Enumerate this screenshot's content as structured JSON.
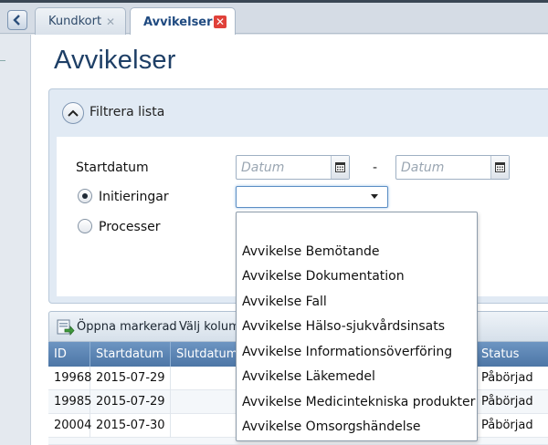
{
  "tabs": [
    {
      "label": "Kundkort",
      "active": false
    },
    {
      "label": "Avvikelser",
      "active": true
    }
  ],
  "page": {
    "title": "Avvikelser"
  },
  "filter": {
    "header_label": "Filtrera lista",
    "startdatum_label": "Startdatum",
    "date_from_placeholder": "Datum",
    "date_to_placeholder": "Datum",
    "range_separator": "-",
    "radio_initieringar": "Initieringar",
    "radio_processer": "Processer",
    "selected_radio": "Initieringar",
    "combo_value": ""
  },
  "dropdown": {
    "options": [
      "",
      "Avvikelse Bemötande",
      "Avvikelse Dokumentation",
      "Avvikelse Fall",
      "Avvikelse Hälso-sjukvårdsinsats",
      "Avvikelse Informationsöverföring",
      "Avvikelse Läkemedel",
      "Avvikelse Medicintekniska produkter",
      "Avvikelse Omsorgshändelse"
    ]
  },
  "toolbar": {
    "open_marked": "Öppna markerad",
    "choose_columns": "Välj kolumner"
  },
  "grid": {
    "columns": [
      "ID",
      "Startdatum",
      "Slutdatum",
      "Status"
    ],
    "rows": [
      {
        "id": "19968",
        "start": "2015-07-29",
        "end": "",
        "status": "Påbörjad"
      },
      {
        "id": "19985",
        "start": "2015-07-29",
        "end": "",
        "status": "Påbörjad"
      },
      {
        "id": "20004",
        "start": "2015-07-30",
        "end": "",
        "status": "Påbörjad"
      }
    ]
  },
  "colors": {
    "accent": "#1e3f66",
    "grid_header": "#5b83b2",
    "close_active": "#e0413a"
  },
  "icons": {
    "back": "chevron-left-icon",
    "tab_close": "close-icon",
    "collapse": "chevron-up-icon",
    "calendar": "calendar-icon",
    "combo_arrow": "caret-down-icon",
    "open": "open-record-icon"
  }
}
